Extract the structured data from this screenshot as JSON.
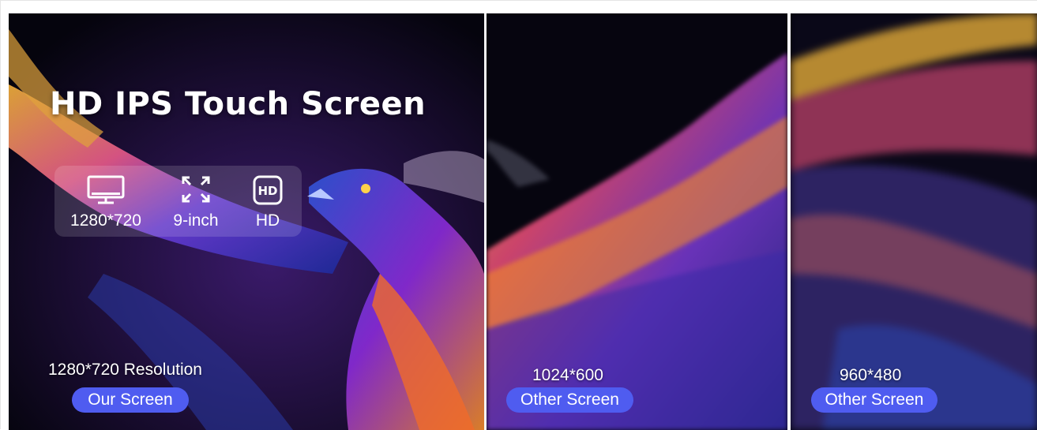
{
  "headline": "HD IPS Touch Screen",
  "specs": [
    {
      "icon": "monitor-icon",
      "label": "1280*720"
    },
    {
      "icon": "expand-icon",
      "label": "9-inch"
    },
    {
      "icon": "hd-icon",
      "label": "HD"
    }
  ],
  "panels": [
    {
      "resolution": "1280*720 Resolution",
      "badge": "Our Screen"
    },
    {
      "resolution": "1024*600",
      "badge": "Other Screen"
    },
    {
      "resolution": "960*480",
      "badge": "Other Screen"
    }
  ],
  "colors": {
    "badge": "#4f5cf0",
    "background": "#05040d"
  }
}
